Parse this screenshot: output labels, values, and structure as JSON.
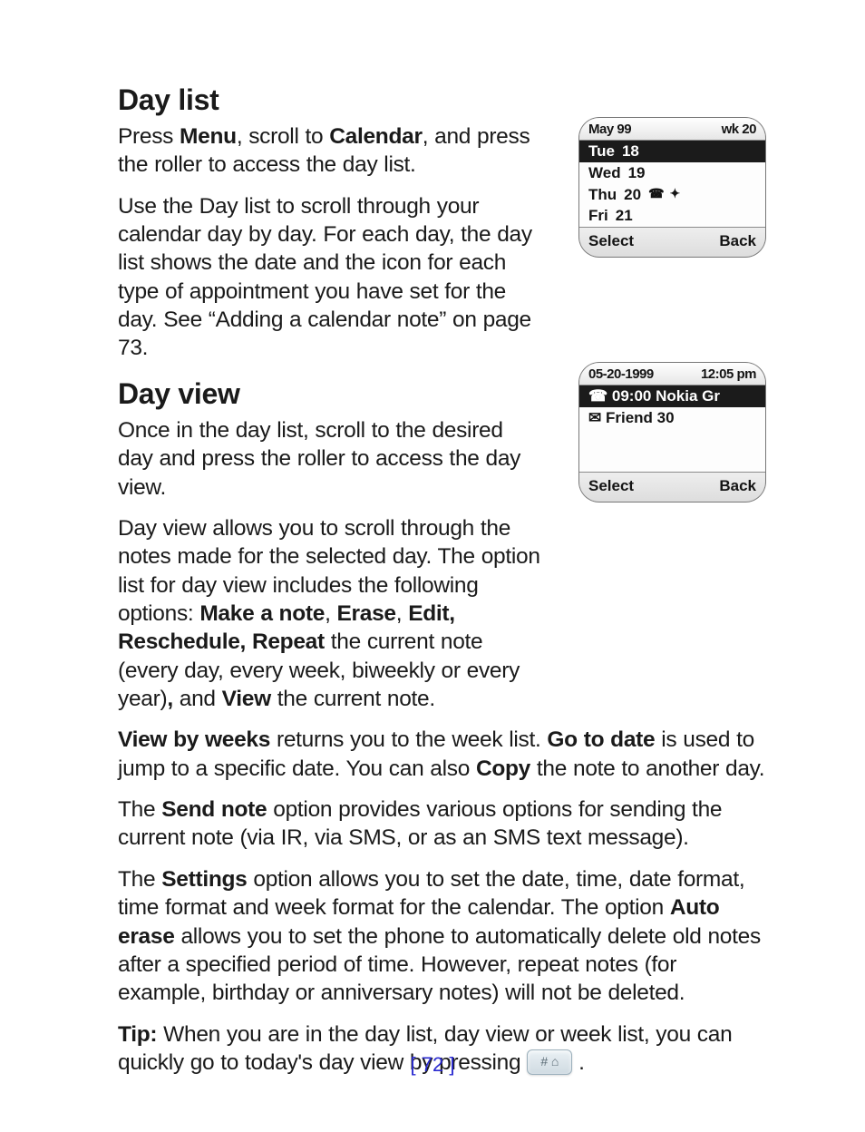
{
  "s1": {
    "title": "Day list",
    "p1a": "Press ",
    "p1b": "Menu",
    "p1c": ", scroll to ",
    "p1d": "Calendar",
    "p1e": ", and press the roller to access the day list.",
    "p2": "Use the Day list to scroll through your calendar day by day. For each day, the day list shows the date and the icon for each type of appointment you have set for the day. See “Adding a calendar note” on page 73."
  },
  "s2": {
    "title": "Day view",
    "p1": "Once in the day list, scroll to the desired day and press the roller to access the day view.",
    "p2a": "Day view allows you to scroll through the notes made for the selected day. The option list for day view includes the following options: ",
    "p2b": "Make a note",
    "p2c": ", ",
    "p2d": "Erase",
    "p2e": ", ",
    "p2f": "Edit, Reschedule, Repeat",
    "p2g": " the current note (every day, every week, biweekly or every year)",
    "p2h": ",",
    "p2i": " and ",
    "p2j": "View",
    "p2k": " the current note."
  },
  "p3": {
    "a": "View by weeks",
    "b": " returns you to the week list. ",
    "c": "Go to date",
    "d": " is used to jump to a specific date. You can also ",
    "e": "Copy",
    "f": " the note to another day."
  },
  "p4": {
    "a": "The ",
    "b": "Send note",
    "c": " option provides various options for sending the current note (via IR, via SMS, or as an SMS text message)."
  },
  "p5": {
    "a": "The ",
    "b": "Settings",
    "c": " option allows you to set the date, time, date format, time format and week format for the calendar. The option ",
    "d": "Auto erase",
    "e": " allows you to set the phone to automatically delete old notes after a specified period of time. However, repeat notes (for example, birthday or anniversary notes) will not be deleted."
  },
  "tip": {
    "label": "Tip:",
    "body1": "  When you are in the day list, day view or week list, you can quickly go to today's day view by pressing ",
    "keylabel": "# ⌂",
    "body2": " ."
  },
  "pagenum": "[ 72 ]",
  "phone1": {
    "top_left": "May 99",
    "top_right": "wk 20",
    "rows": [
      {
        "a": "Tue",
        "b": "18",
        "c": "",
        "sel": true
      },
      {
        "a": "Wed",
        "b": "19",
        "c": ""
      },
      {
        "a": "Thu",
        "b": "20",
        "c": "icons"
      },
      {
        "a": "Fri",
        "b": "21",
        "c": ""
      }
    ],
    "soft_left": "Select",
    "soft_right": "Back"
  },
  "phone2": {
    "top_left": "05-20-1999",
    "top_right": "12:05 pm",
    "rows": [
      {
        "a": "☎ 09:00 Nokia Gr",
        "sel": true
      },
      {
        "a": "✉ Friend 30"
      }
    ],
    "soft_left": "Select",
    "soft_right": "Back"
  }
}
